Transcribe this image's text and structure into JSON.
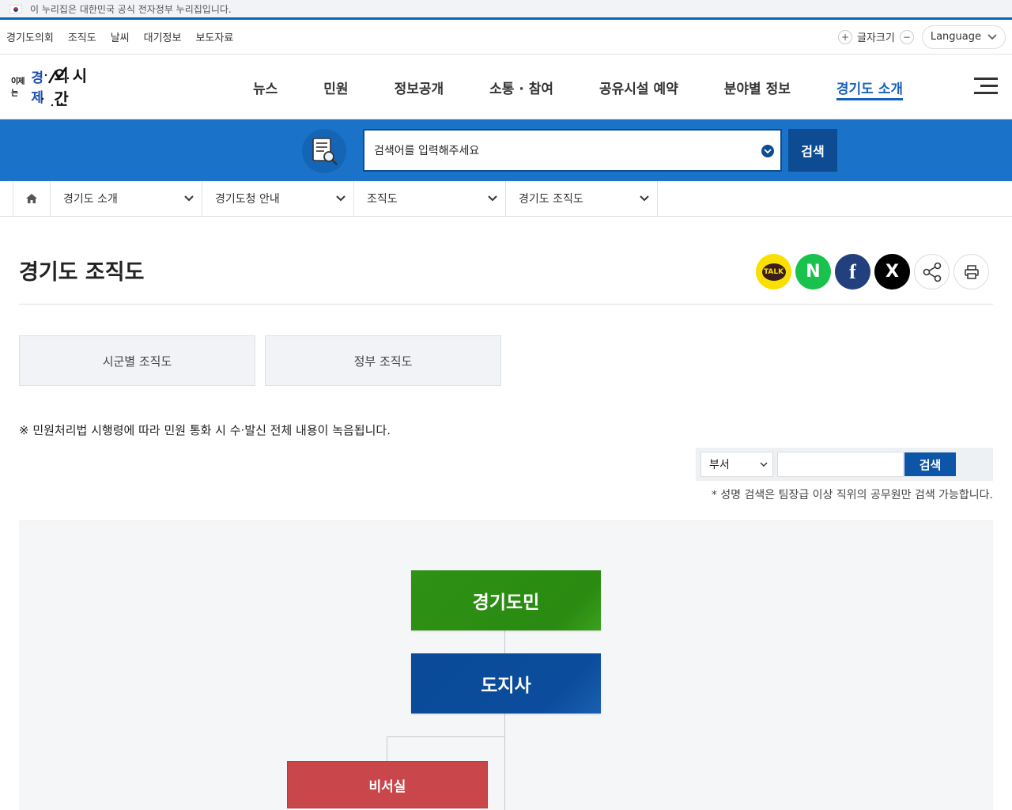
{
  "gov_banner": {
    "text": "이 누리집은 대한민국 공식 전자정부 누리집입니다."
  },
  "util": {
    "links": [
      "경기도의회",
      "조직도",
      "날씨",
      "대기정보",
      "보도자료"
    ],
    "font_label": "글자크기",
    "lang_label": "Language"
  },
  "logo": {
    "part1": "이제는",
    "part2": "경제",
    "part3": "의 시간"
  },
  "gnb": [
    {
      "label": "뉴스"
    },
    {
      "label": "민원"
    },
    {
      "label": "정보공개"
    },
    {
      "label": "소통 · 참여"
    },
    {
      "label": "공유시설 예약"
    },
    {
      "label": "분야별 정보"
    },
    {
      "label": "경기도 소개"
    }
  ],
  "search": {
    "placeholder": "검색어를 입력해주세요",
    "button": "검색"
  },
  "breadcrumb": [
    "경기도 소개",
    "경기도청 안내",
    "조직도",
    "경기도 조직도"
  ],
  "page": {
    "title": "경기도 조직도"
  },
  "share": {
    "kakao": "TALK",
    "naver": "N",
    "facebook": "f",
    "x": "X"
  },
  "tabs": [
    "시군별 조직도",
    "정부 조직도"
  ],
  "notice": "※ 민원처리법 시행령에 따라 민원 통화 시 수·발신 전체 내용이 녹음됩니다.",
  "dept_search": {
    "select_value": "부서",
    "button": "검색",
    "note": "* 성명 검색은 팀장급 이상 직위의 공무원만 검색 가능합니다."
  },
  "org": {
    "citizens": "경기도민",
    "governor": "도지사",
    "secretariat": "비서실"
  },
  "colors": {
    "accent": "#1762b8",
    "search_band": "#1a73c8",
    "citizens_box": "#2e9214",
    "governor_box": "#0a4a98",
    "secretariat_box": "#c9474a"
  }
}
